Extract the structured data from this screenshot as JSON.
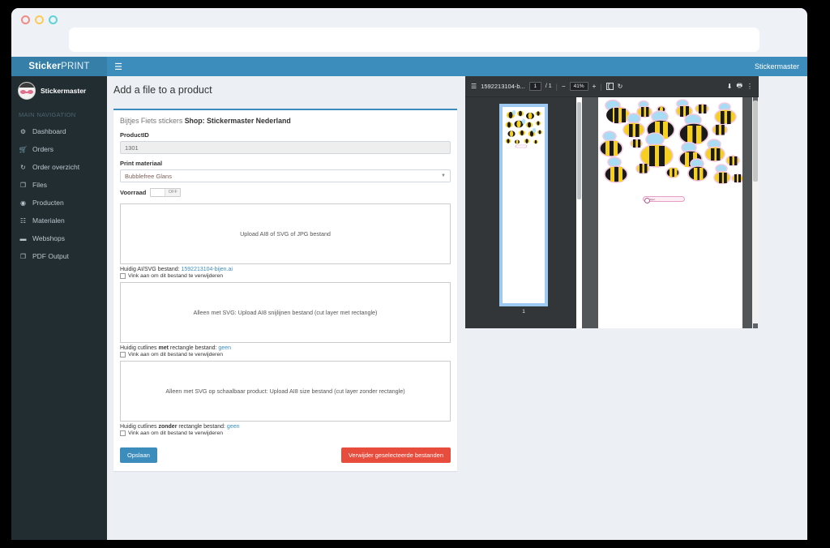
{
  "browser": {
    "url_value": "",
    "url_placeholder": "",
    "traffic_lights": [
      "close-red",
      "minimize-yellow",
      "maximize-cyan"
    ]
  },
  "navbar": {
    "logo_bold": "Sticker",
    "logo_light": "PRINT",
    "toggle_icon": "hamburger-icon",
    "user_label": "Stickermaster",
    "bg_color": "#3c8dbc"
  },
  "sidebar": {
    "user": {
      "name": "Stickermaster",
      "avatar_icon": "user-avatar"
    },
    "nav_header": "MAIN NAVIGATION",
    "items": [
      {
        "label": "Dashboard",
        "icon": "dashboard-icon",
        "glyph": "⚙"
      },
      {
        "label": "Orders",
        "icon": "cart-icon",
        "glyph": "Ὥ2"
      },
      {
        "label": "Order overzicht",
        "icon": "refresh-icon",
        "glyph": "↻"
      },
      {
        "label": "Files",
        "icon": "files-icon",
        "glyph": "❐"
      },
      {
        "label": "Producten",
        "icon": "product-icon",
        "glyph": "◉"
      },
      {
        "label": "Materialen",
        "icon": "materials-icon",
        "glyph": "☷"
      },
      {
        "label": "Webshops",
        "icon": "briefcase-icon",
        "glyph": "▬"
      },
      {
        "label": "PDF Output",
        "icon": "copy-icon",
        "glyph": "❐"
      }
    ],
    "bg_color": "#222d32"
  },
  "main": {
    "page_title": "Add a file to a product",
    "box": {
      "title_prefix": "Bijtjes Fiets stickers ",
      "title_bold": "Shop: Stickermaster Nederland",
      "product_id_label": "ProductID",
      "product_id_value": "1301",
      "material_label": "Print materiaal",
      "material_value": "Bubblefree Glans",
      "voorraad_label": "Voorraad",
      "voorraad_state": "OFF",
      "dropzones": [
        {
          "text": "Upload AI8 of SVG of JPG bestand",
          "current_prefix": "Huidig AI/SVG bestand: ",
          "current_value": "1592213104-bijen.ai",
          "checkbox_label": "Vink aan om dit bestand te verwijderen",
          "checked": false
        },
        {
          "text": "Alleen met SVG: Upload AI8 snijlijnen bestand (cut layer met rectangle)",
          "current_prefix": "Huidig cutlines ",
          "current_bold": "met",
          "current_suffix": " rectangle bestand: ",
          "current_value": "geen",
          "checkbox_label": "Vink aan om dit bestand te verwijderen",
          "checked": false
        },
        {
          "text": "Alleen met SVG op schaalbaar product: Upload AI8 size bestand (cut layer zonder rectangle)",
          "current_prefix": "Huidig cutlines ",
          "current_bold": "zonder",
          "current_suffix": " rectangle bestand: ",
          "current_value": "geen",
          "checkbox_label": "Vink aan om dit bestand te verwijderen",
          "checked": false
        }
      ],
      "save_button": "Opslaan",
      "delete_button": "Verwijder geselecteerde bestanden",
      "accent_color": "#3c8dbc",
      "danger_color": "#e74c3c"
    }
  },
  "pdf_viewer": {
    "toolbar": {
      "sidebar_toggle_icon": "hamburger-icon",
      "file_name": "1592213104-b...",
      "page_current": "1",
      "page_total": "/ 1",
      "zoom_out_icon": "minus-icon",
      "zoom_value": "41%",
      "zoom_in_icon": "plus-icon",
      "fit_page_icon": "fit-page-icon",
      "rotate_icon": "rotate-icon",
      "download_icon": "download-icon",
      "print_icon": "print-icon",
      "more_icon": "kebab-menu-icon"
    },
    "thumbnail": {
      "page_label": "1"
    },
    "page_content": {
      "mini_label_text": "bijen",
      "description": "bee stickers artwork"
    },
    "bg_color": "#323639"
  }
}
